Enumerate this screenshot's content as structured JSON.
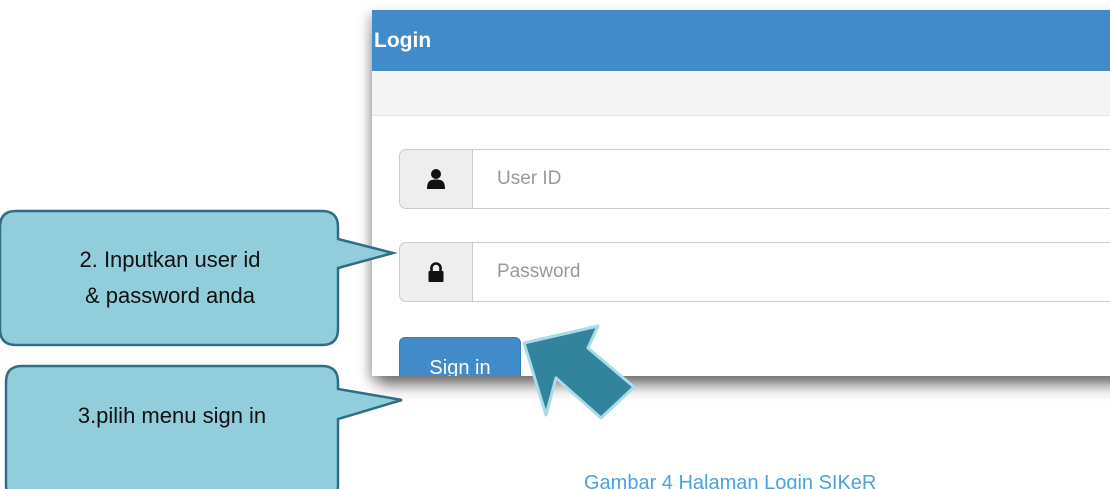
{
  "login": {
    "title": "Login",
    "user_id_placeholder": "User ID",
    "password_placeholder": "Password",
    "sign_in_label": "Sign in",
    "icons": {
      "user": "user-icon",
      "password": "lock-icon"
    }
  },
  "callouts": {
    "step2_line1": "2. Inputkan user id",
    "step2_line2": "& password anda",
    "step3": "3.pilih menu sign in"
  },
  "caption": "Gambar 4 Halaman Login SIKeR",
  "colors": {
    "header": "#428bca",
    "callout_fill": "#92cddc",
    "callout_border": "#2e6f87",
    "arrow": "#31849b",
    "caption": "#4aa3df"
  }
}
